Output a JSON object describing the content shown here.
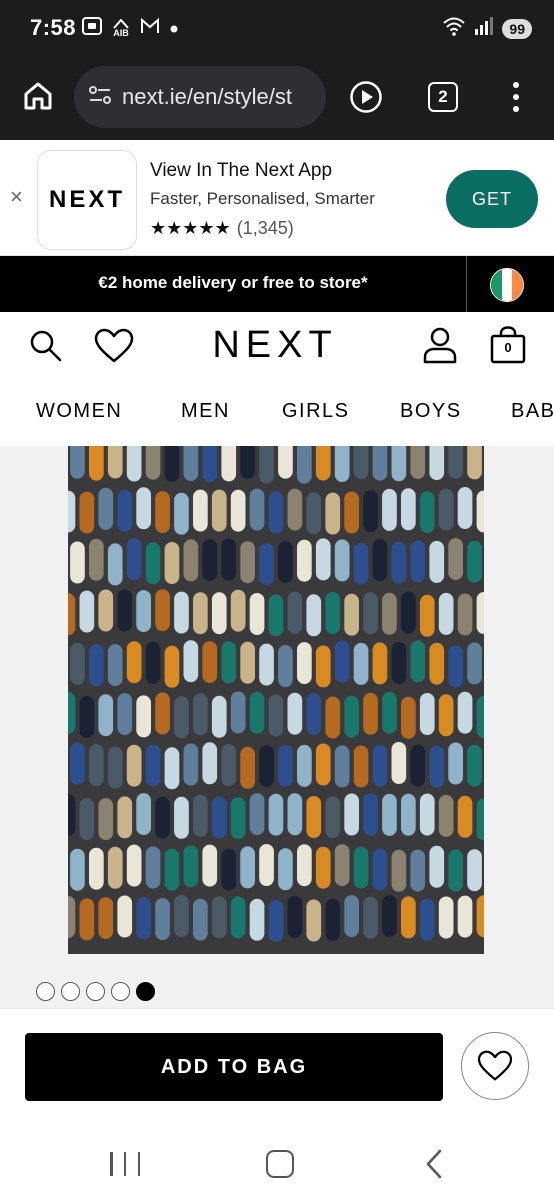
{
  "status_bar": {
    "time": "7:58",
    "left_icons": [
      "screenshot-icon",
      "aib-notification-icon",
      "gmail-icon",
      "dot-icon"
    ],
    "aib_label": "AIB",
    "battery": "99"
  },
  "browser": {
    "url": "next.ie/en/style/st",
    "tab_count": "2"
  },
  "app_banner": {
    "close": "×",
    "logo_text": "NEXT",
    "title": "View In The Next App",
    "subtitle": "Faster, Personalised, Smarter",
    "stars": "★★★★★",
    "rating_count": "(1,345)",
    "get_label": "GET",
    "get_color": "#0b6e63"
  },
  "promo": {
    "text": "€2 home delivery or free to store*",
    "flag_colors": [
      "#169b62",
      "#ffffff",
      "#ff883e"
    ]
  },
  "header": {
    "logo": "NEXT",
    "bag_count": "0"
  },
  "nav": {
    "items": [
      "WOMEN",
      "MEN",
      "GIRLS",
      "BOYS",
      "BABY"
    ]
  },
  "product": {
    "image_alt": "multicoloured pebble pattern rug",
    "palette": [
      "#1b2233",
      "#2e4f8f",
      "#5f7f9c",
      "#8fb3c9",
      "#c6d9e3",
      "#e9e6d8",
      "#d98b22",
      "#b56a1f",
      "#17786b",
      "#8b8270",
      "#c9b48a",
      "#4a5a66"
    ],
    "carousel_total": 5,
    "carousel_active": 5
  },
  "actions": {
    "add_to_bag": "ADD TO BAG"
  }
}
